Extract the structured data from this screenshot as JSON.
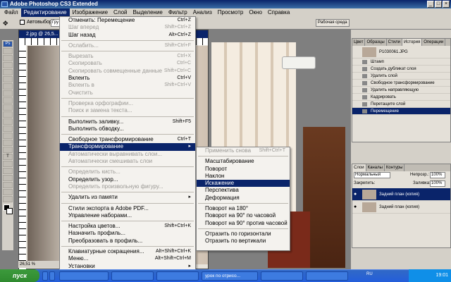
{
  "app": {
    "title": "Adobe Photoshop CS3 Extended"
  },
  "menubar": {
    "items": [
      "Файл",
      "Редактирование",
      "Изображение",
      "Слой",
      "Выделение",
      "Фильтр",
      "Анализ",
      "Просмотр",
      "Окно",
      "Справка"
    ]
  },
  "options": {
    "auto_label": "Автовыбор:",
    "group_value": "Гру",
    "workspace": "Рабочая среда"
  },
  "document": {
    "title": "2.jpg @ 26,5...",
    "zoom": "26,51 %"
  },
  "edit_menu": [
    {
      "label": "Отменить: Перемещение",
      "shortcut": "Ctrl+Z",
      "enabled": true
    },
    {
      "label": "Шаг вперед",
      "shortcut": "Shift+Ctrl+Z",
      "enabled": false
    },
    {
      "label": "Шаг назад",
      "shortcut": "Alt+Ctrl+Z",
      "enabled": true
    },
    {
      "sep": true
    },
    {
      "label": "Ослабить...",
      "shortcut": "Shift+Ctrl+F",
      "enabled": false
    },
    {
      "sep": true
    },
    {
      "label": "Вырезать",
      "shortcut": "Ctrl+X",
      "enabled": false
    },
    {
      "label": "Скопировать",
      "shortcut": "Ctrl+C",
      "enabled": false
    },
    {
      "label": "Скопировать совмещенные данные",
      "shortcut": "Shift+Ctrl+C",
      "enabled": false
    },
    {
      "label": "Вклеить",
      "shortcut": "Ctrl+V",
      "enabled": true
    },
    {
      "label": "Вклеить в",
      "shortcut": "Shift+Ctrl+V",
      "enabled": false
    },
    {
      "label": "Очистить",
      "shortcut": "",
      "enabled": false
    },
    {
      "sep": true
    },
    {
      "label": "Проверка орфографии...",
      "shortcut": "",
      "enabled": false
    },
    {
      "label": "Поиск и замена текста...",
      "shortcut": "",
      "enabled": false
    },
    {
      "sep": true
    },
    {
      "label": "Выполнить заливку...",
      "shortcut": "Shift+F5",
      "enabled": true
    },
    {
      "label": "Выполнить обводку...",
      "shortcut": "",
      "enabled": true
    },
    {
      "sep": true
    },
    {
      "label": "Свободное трансформирование",
      "shortcut": "Ctrl+T",
      "enabled": true
    },
    {
      "label": "Трансформирование",
      "shortcut": "▸",
      "enabled": true,
      "highlight": true
    },
    {
      "label": "Автоматически выравнивать слои...",
      "shortcut": "",
      "enabled": false
    },
    {
      "label": "Автоматически смешивать слои",
      "shortcut": "",
      "enabled": false
    },
    {
      "sep": true
    },
    {
      "label": "Определить кисть...",
      "shortcut": "",
      "enabled": false
    },
    {
      "label": "Определить узор...",
      "shortcut": "",
      "enabled": true
    },
    {
      "label": "Определить произвольную фигуру...",
      "shortcut": "",
      "enabled": false
    },
    {
      "sep": true
    },
    {
      "label": "Удалить из памяти",
      "shortcut": "▸",
      "enabled": true
    },
    {
      "sep": true
    },
    {
      "label": "Стили экспорта в Adobe PDF...",
      "shortcut": "",
      "enabled": true
    },
    {
      "label": "Управление наборами...",
      "shortcut": "",
      "enabled": true
    },
    {
      "sep": true
    },
    {
      "label": "Настройка цветов...",
      "shortcut": "Shift+Ctrl+K",
      "enabled": true
    },
    {
      "label": "Назначить профиль...",
      "shortcut": "",
      "enabled": true
    },
    {
      "label": "Преобразовать в профиль...",
      "shortcut": "",
      "enabled": true
    },
    {
      "sep": true
    },
    {
      "label": "Клавиатурные сокращения...",
      "shortcut": "Alt+Shift+Ctrl+K",
      "enabled": true
    },
    {
      "label": "Меню...",
      "shortcut": "Alt+Shift+Ctrl+M",
      "enabled": true
    },
    {
      "label": "Установки",
      "shortcut": "▸",
      "enabled": true
    }
  ],
  "transform_menu": [
    {
      "label": "Применить снова",
      "shortcut": "Shift+Ctrl+T",
      "enabled": false
    },
    {
      "sep": true
    },
    {
      "label": "Масштабирование",
      "enabled": true
    },
    {
      "label": "Поворот",
      "enabled": true
    },
    {
      "label": "Наклон",
      "enabled": true
    },
    {
      "label": "Искажение",
      "enabled": true,
      "highlight": true
    },
    {
      "label": "Перспектива",
      "enabled": true
    },
    {
      "label": "Деформация",
      "enabled": true
    },
    {
      "sep": true
    },
    {
      "label": "Поворот на 180°",
      "enabled": true
    },
    {
      "label": "Поворот на 90° по часовой",
      "enabled": true
    },
    {
      "label": "Поворот на 90° против часовой",
      "enabled": true
    },
    {
      "sep": true
    },
    {
      "label": "Отразить по горизонтали",
      "enabled": true
    },
    {
      "label": "Отразить по вертикали",
      "enabled": true
    }
  ],
  "history_panel": {
    "tabs": [
      "Цвет",
      "Образцы",
      "Стили",
      "История",
      "Операции"
    ],
    "snapshot": "P1030061.JPG",
    "items": [
      "Штамп",
      "Создать дубликат слоя",
      "Удалить слой",
      "Свободное трансформирование",
      "Удалить направляющую",
      "Кадрировать",
      "Перетащите слой",
      "Перемещение"
    ]
  },
  "layers_panel": {
    "tabs": [
      "Слои",
      "Каналы",
      "Контуры"
    ],
    "blend_mode": "Нормальный",
    "opacity_label": "Непрозр.:",
    "opacity": "100%",
    "lock_label": "Закрепить:",
    "fill_label": "Заливка:",
    "fill": "100%",
    "layers": [
      "Задний план (копия)",
      "Задний план (копия)"
    ]
  },
  "taskbar": {
    "start": "пуск",
    "task": "урок по отрисо...",
    "lang": "RU",
    "time": "19:01"
  }
}
